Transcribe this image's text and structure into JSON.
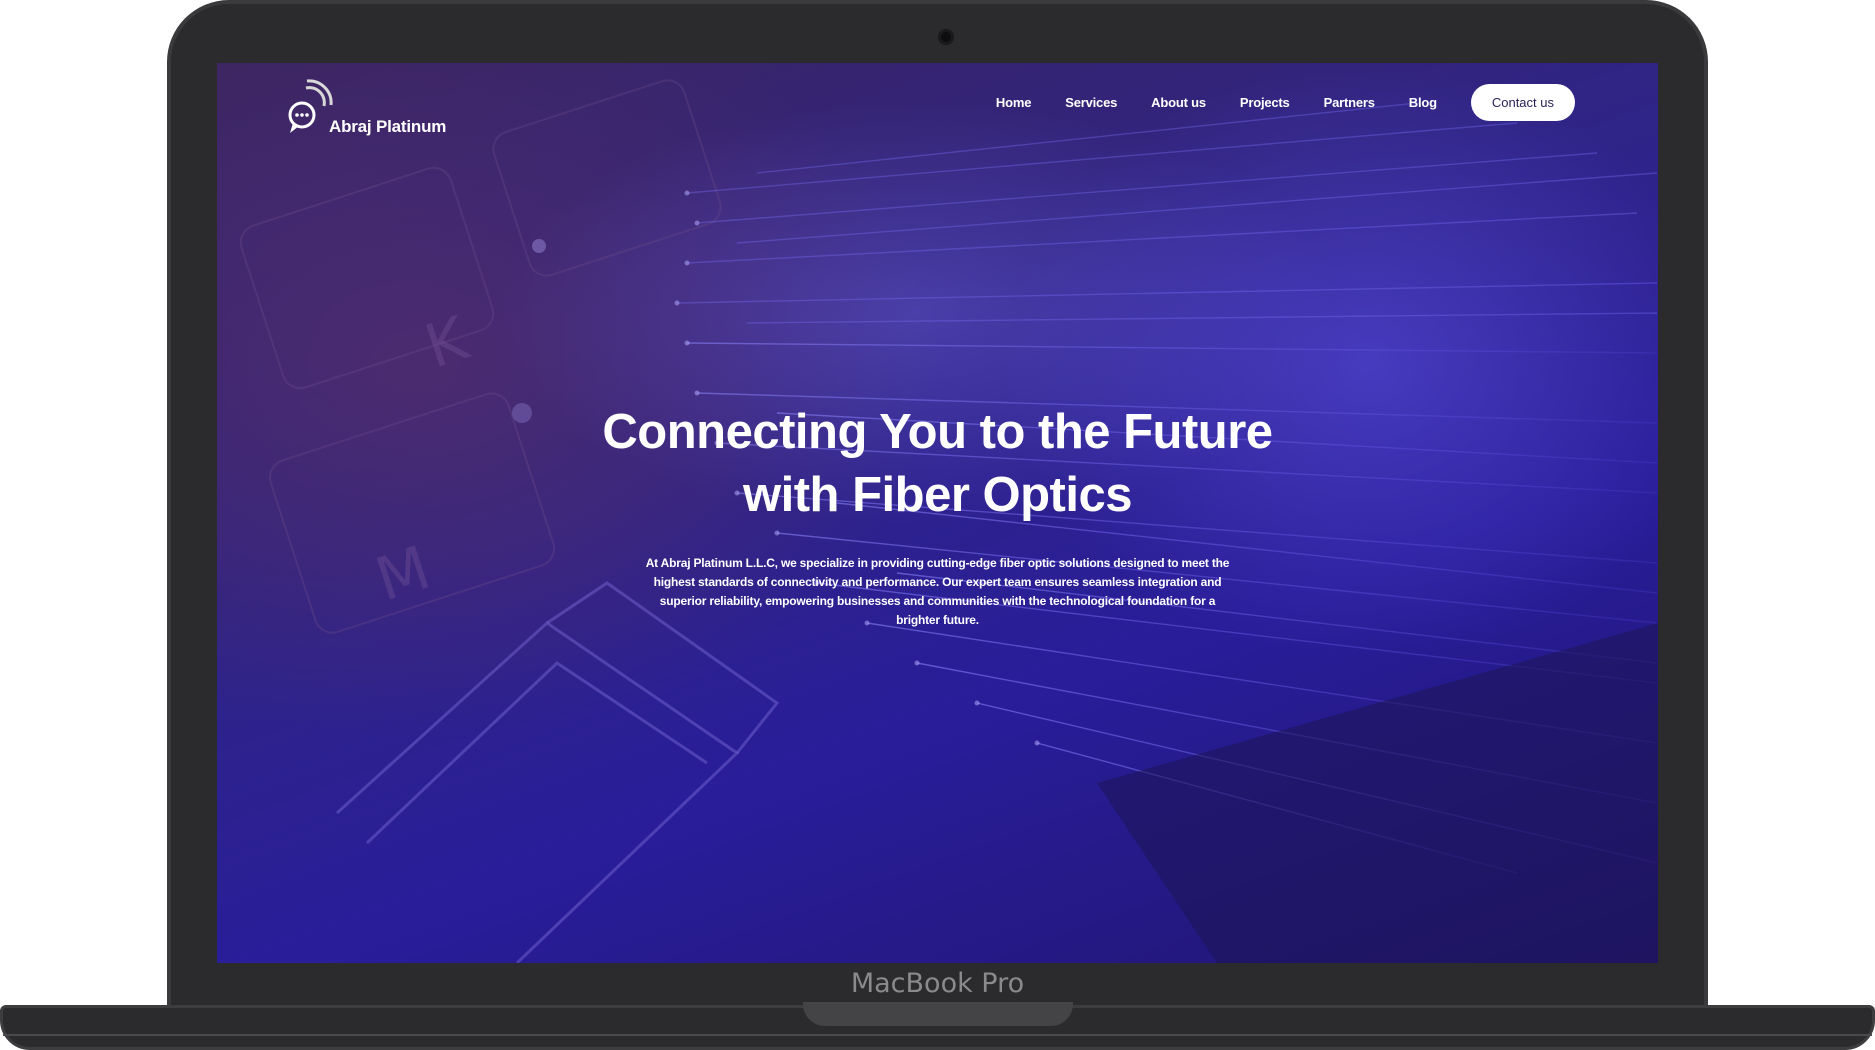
{
  "device": {
    "model_label": "MacBook Pro"
  },
  "brand": {
    "name": "Abraj Platinum",
    "logo_icon": "chat-bubble-wifi-icon"
  },
  "nav": {
    "items": [
      {
        "label": "Home"
      },
      {
        "label": "Services"
      },
      {
        "label": "About us"
      },
      {
        "label": "Projects"
      },
      {
        "label": "Partners"
      },
      {
        "label": "Blog"
      }
    ],
    "cta_label": "Contact us"
  },
  "hero": {
    "title_line1": "Connecting You to the Future",
    "title_line2": "with Fiber Optics",
    "description": "At Abraj Platinum L.L.C, we specialize in providing cutting-edge fiber optic solutions designed to meet the highest standards of connectivity and performance. Our expert team ensures seamless integration and superior reliability, empowering businesses and communities with the technological foundation for a brighter future."
  },
  "colors": {
    "screen_bg": "#2f2487",
    "accent_purple": "#5c50e6",
    "button_bg": "#ffffff",
    "button_text": "#2a1f5a",
    "device_body": "#2b2b2d"
  }
}
